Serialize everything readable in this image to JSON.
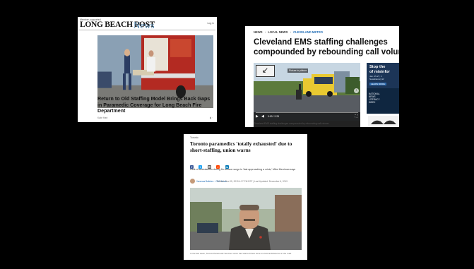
{
  "lbp": {
    "tagline": "Member-supported",
    "brand": "LONG BEACH POST",
    "brand_news": "News",
    "signin": "Log in",
    "headline": "Return to Old Staffing Model Brings Back Gaps in Paramedic Coverage for Long Beach Fire Department",
    "byline": "Kate Hart"
  },
  "cle": {
    "crumbs": {
      "news": "NEWS",
      "local": "LOCAL NEWS",
      "metro": "CLEVELAND METRO"
    },
    "headline_line1": "Cleveland EMS staffing challenges",
    "headline_line2": "compounded by rebounding call volume",
    "video_overlay": "Picture in picture",
    "video_time": "0:00 / 2:25",
    "ad_title_line1": "Stop the",
    "ad_title_line2": "of misinfor",
    "ad_sub_line1": "Jan. 25-27, 2",
    "ad_sub_line2": "Newsliteracy.W",
    "ad_button": "LEARN MORE",
    "promo_line1": "NATIONAL",
    "promo_line2": "NEWS",
    "promo_line3": "LITERACY",
    "promo_line4": "WEEK"
  },
  "tor": {
    "section": "Toronto",
    "headline": "Toronto paramedics 'totally exhausted' due to short-staffing, union warns",
    "dek": "Lack of ambulances during flu season surge is 'fast approaching a crisis,' Mike Merriman says",
    "author": "Vanessa Balintec · CBC News",
    "dateline": "Posted: Dec 05, 2019 4:27 PM EST | Last Updated: December 6, 2019"
  },
  "colors": {
    "background": "#000000",
    "cbc_link": "#1d6ab4",
    "lbp_news": "#4f80a8"
  },
  "icons": [
    "facebook-icon",
    "twitter-icon",
    "email-icon",
    "reddit-icon",
    "linkedin-icon"
  ]
}
